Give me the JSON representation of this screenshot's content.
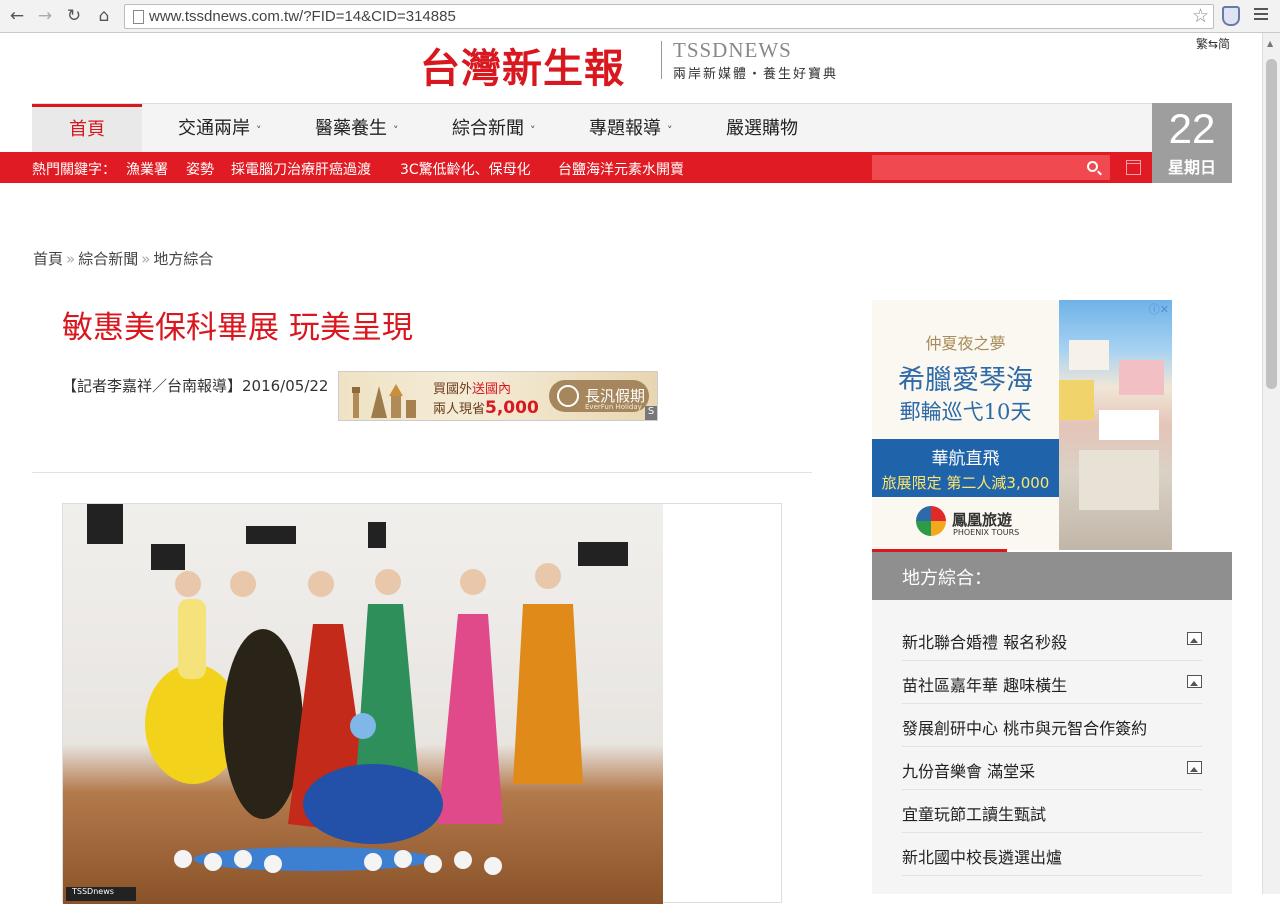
{
  "browser": {
    "url": "www.tssdnews.com.tw/?FID=14&CID=314885"
  },
  "header": {
    "logo_cn": "台灣新生報",
    "logo_en": "TSSDNEWS",
    "tagline": "兩岸新媒體・養生好寶典",
    "lang_toggle": "繁⇆简"
  },
  "nav": {
    "items": [
      {
        "label": "首頁",
        "active": true
      },
      {
        "label": "交通兩岸",
        "dropdown": true
      },
      {
        "label": "醫藥養生",
        "dropdown": true
      },
      {
        "label": "綜合新聞",
        "dropdown": true
      },
      {
        "label": "專題報導",
        "dropdown": true
      },
      {
        "label": "嚴選購物",
        "dropdown": false
      }
    ]
  },
  "keywords": {
    "label": "熱門關鍵字：",
    "items": [
      "漁業署",
      "姿勢",
      "採電腦刀治療肝癌過渡",
      "3C驚低齡化、保母化",
      "台鹽海洋元素水開賣"
    ]
  },
  "date": {
    "day": "22",
    "weekday": "星期日"
  },
  "breadcrumb": {
    "items": [
      "首頁",
      "綜合新聞",
      "地方綜合"
    ],
    "separator": "»"
  },
  "article": {
    "title": "敏惠美保科畢展 玩美呈現",
    "byline": "【記者李嘉祥／台南報導】2016/05/22",
    "photo_tag": "TSSDnews"
  },
  "inline_ad": {
    "line1_a": "買國外",
    "line1_b": "送國內",
    "line2_a": "兩人現省",
    "line2_b": "5,000",
    "brand": "長汎假期",
    "brand_sub": "EverFun Holiday",
    "corner": "S"
  },
  "side_ad": {
    "dream": "仲夏夜之夢",
    "destination": "希臘愛琴海",
    "cruise": "郵輪巡弋10天",
    "airline": "華航直飛",
    "promo": "旅展限定 第二人減3,000",
    "brand": "鳳凰旅遊",
    "brand_en": "PHOENIX TOURS",
    "adchoices": "ⓘ✕"
  },
  "sidebar": {
    "title": "地方綜合：",
    "items": [
      {
        "label": "新北聯合婚禮 報名秒殺",
        "has_image": true
      },
      {
        "label": "苗社區嘉年華 趣味橫生",
        "has_image": true
      },
      {
        "label": "發展創研中心 桃市與元智合作簽約",
        "has_image": false
      },
      {
        "label": "九份音樂會 滿堂采",
        "has_image": true
      },
      {
        "label": "宜童玩節工讀生甄試",
        "has_image": false
      },
      {
        "label": "新北國中校長遴選出爐",
        "has_image": false
      }
    ]
  },
  "colors": {
    "brand_red": "#d8171f",
    "keyword_bar": "#e01b23",
    "date_gray": "#9e9e9e",
    "sidebar_header": "#8f8f8f"
  }
}
